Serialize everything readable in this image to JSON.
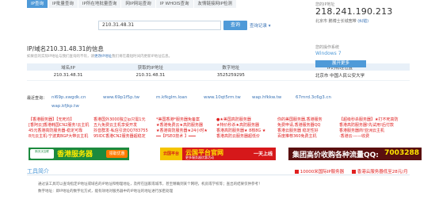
{
  "tabs": [
    "IP查询",
    "IP批量查询",
    "IP所在地批量查询",
    "网IP网站查询",
    "IP WHOIS查询",
    "友情链接网IP检测"
  ],
  "search": {
    "value": "210.31.48.31",
    "button": "查询",
    "log": "查询记录 ▾"
  },
  "result": {
    "title": "IP/域名210.31.48.31的信息",
    "note_prefix": "如果您的实际IP地址与我们查询的不符，请",
    "note_link": "更改IP地址",
    "note_suffix": "我们将在最短时间内更新IP地址信息。",
    "headers": [
      "域名/IP",
      "获取的IP地址",
      "数字地址",
      "IP的物理位置"
    ],
    "row": [
      "210.31.48.31",
      "210.31.48.31",
      "3525259295",
      "北京市 中国人民公安大学"
    ],
    "recent_label": "最近查询：",
    "recent_row1": [
      "nl69p.xwgdk.cn",
      "www.69p1f5p.tw",
      "m.kfkglm.loan",
      "www.10qt5rm.tw",
      "wap.hfkkw.tw",
      "67mrd.3c6g3.cn"
    ],
    "recent_row2": [
      "wap.kfjkp.tw"
    ]
  },
  "right_panel": {
    "my_ip_label": "您的IP地址",
    "my_ip": "218.241.190.213",
    "location_label": "北京市 鹏博士长城宽带",
    "location_link": "(纠错)",
    "os_label": "您的操作系统",
    "os": "Windows 7",
    "expand_button": "展开更多"
  },
  "ads": {
    "col1": [
      "【香港服务器】【无死均】",
      "[香阿云]香港韩国CN2服务!云主机",
      "45元香港高防服务器-稳定可靠",
      "8元云主机-宁波真BGP大带云主机"
    ],
    "col2": [
      "香港国外3000独立ip只需1元",
      "五九免费云主机享受开发",
      "抖音群发-私信引流QQ783755",
      "95IDC香港CN2服务器超稳定"
    ],
    "col3": [
      "*美国香港*服务器免备案",
      "★香港免费云★高防服务器",
      "★香港高防服务器★24小时★",
      "━━【PSEO技术 】━━━"
    ],
    "col4": [
      "●★美国高防服务器",
      "★特价秒杀★高防服务器",
      "香港高防服务器★ 8核8G ★",
      "香港高防云服务器超低价"
    ],
    "col5": [
      "你的美国服务器,香港服务",
      "免费申请,香港服务器QQ",
      "香港云服务器 稳定性好",
      "百度推荐360免费主机"
    ],
    "col6": [
      "【超级秒杀服务器】★打不死高防",
      "香港高防服务器!先试用!后付款",
      "香港服务器商!亚洲云主机",
      "·香港云·——收费"
    ],
    "banner1": {
      "logo": "斯天沃互联",
      "text": "香港服务器",
      "button": "领取优惠"
    },
    "banner2": {
      "logo": "云国平台",
      "text": "云国平台官网",
      "sub": "更多服务器优惠活动",
      "tag": "一天上线"
    },
    "banner3": {
      "text": "集团高价收购各种流量QQ:",
      "number": "7003288"
    },
    "tools_ad1": "10000米国际IP服务器",
    "tools_ad2": "香港云服务器低至28元/月"
  },
  "tools": {
    "title": "工具简介",
    "line1": "通过该工具可以查询指定IP地址或域名的IP地址和物理地址，及所在国家或城市，甚至精确到某个网吧，机房或学校等；查出的结果仅供参考！",
    "line2": "数字地址：即IP地址的数字化方式，能有效地对服务器中的IP地址的地址进行加密处理"
  }
}
